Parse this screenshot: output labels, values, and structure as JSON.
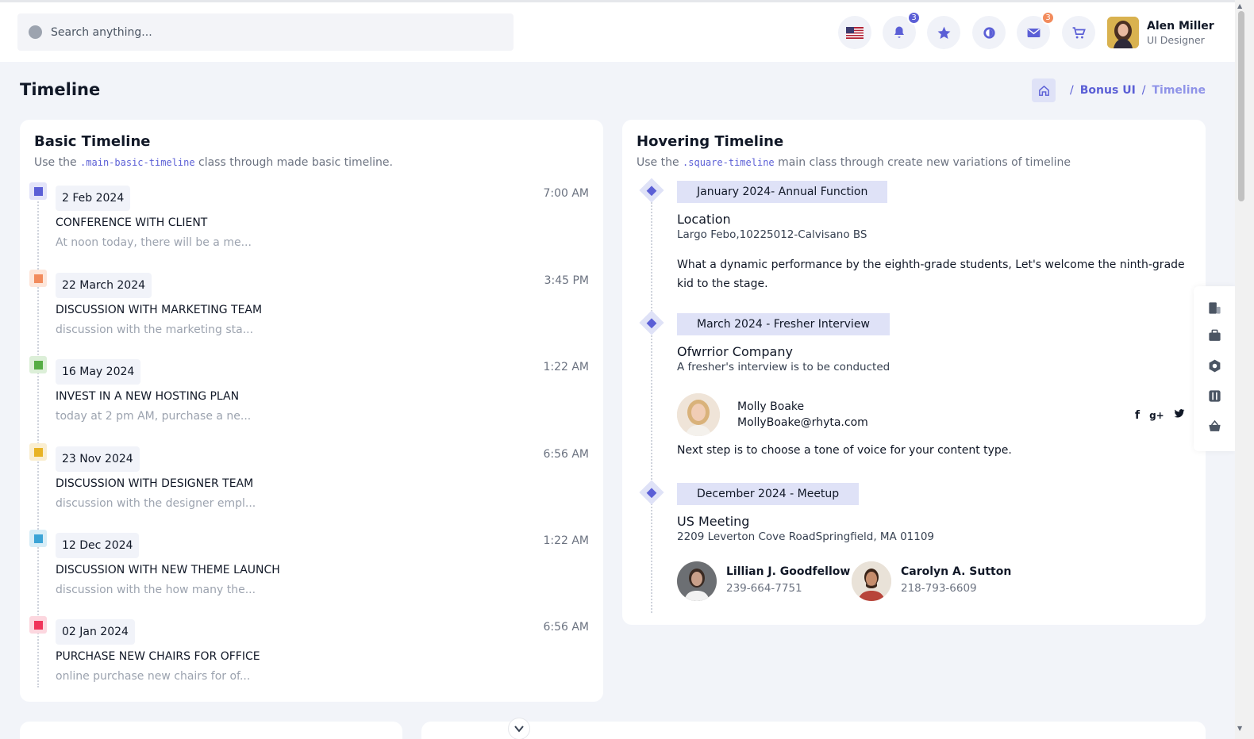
{
  "search": {
    "placeholder": "Search anything..."
  },
  "header": {
    "badges": {
      "notifications": "3",
      "messages": "3"
    },
    "user": {
      "name": "Alen Miller",
      "role": "UI Designer"
    }
  },
  "page": {
    "title": "Timeline"
  },
  "breadcrumb": {
    "parent": "Bonus UI",
    "sep1": "/",
    "sep2": "/",
    "current": "Timeline"
  },
  "basic_timeline": {
    "title": "Basic Timeline",
    "sub_before": "Use the",
    "sub_code": ".main-basic-timeline",
    "sub_after": "class through made basic timeline.",
    "items": [
      {
        "date": "2 Feb 2024",
        "time": "7:00 AM",
        "title": "CONFERENCE WITH CLIENT",
        "desc": "At noon today, there will be a me...",
        "color": "#5b5fd6",
        "bg": "#e3e4f9"
      },
      {
        "date": "22 March 2024",
        "time": "3:45 PM",
        "title": "DISCUSSION WITH MARKETING TEAM",
        "desc": "discussion with the marketing sta...",
        "color": "#f28b5c",
        "bg": "#fde6da"
      },
      {
        "date": "16 May 2024",
        "time": "1:22 AM",
        "title": "INVEST IN A NEW HOSTING PLAN",
        "desc": "today at 2 pm AM, purchase a ne...",
        "color": "#55ad44",
        "bg": "#dcefd8"
      },
      {
        "date": "23 Nov 2024",
        "time": "6:56 AM",
        "title": "DISCUSSION WITH DESIGNER TEAM",
        "desc": "discussion with the designer empl...",
        "color": "#e8b324",
        "bg": "#faeed0"
      },
      {
        "date": "12 Dec 2024",
        "time": "1:22 AM",
        "title": "DISCUSSION WITH NEW THEME LAUNCH",
        "desc": "discussion with the how many the...",
        "color": "#3ba4d6",
        "bg": "#d7edf7"
      },
      {
        "date": "02 Jan 2024",
        "time": "6:56 AM",
        "title": "PURCHASE NEW CHAIRS FOR OFFICE",
        "desc": "online purchase new chairs for of...",
        "color": "#f0345a",
        "bg": "#fcd7df"
      }
    ]
  },
  "hovering_timeline": {
    "title": "Hovering Timeline",
    "sub_before": "Use the",
    "sub_code": ".square-timeline",
    "sub_after": "main class through create new variations of timeline",
    "event1": {
      "date": "January 2024- Annual Function",
      "heading": "Location",
      "address": "Largo Febo,10225012-Calvisano BS",
      "text": "What a dynamic performance by the eighth-grade students, Let's welcome the ninth-grade kid to the stage."
    },
    "event2": {
      "date": "March 2024 - Fresher Interview",
      "heading": "Ofwrrior Company",
      "detail": "A fresher's interview is to be conducted",
      "person_name": "Molly Boake",
      "person_email": "MollyBoake@rhyta.com",
      "social": [
        "f",
        "g+",
        "t"
      ],
      "note": "Next step is to choose a tone of voice for your content type."
    },
    "event3": {
      "date": "December 2024 - Meetup",
      "heading": "US Meeting",
      "address": "2209 Leverton Cove RoadSpringfield, MA 01109",
      "people": [
        {
          "name": "Lillian J. Goodfellow",
          "phone": "239-664-7751"
        },
        {
          "name": "Carolyn A. Sutton",
          "phone": "218-793-6609"
        }
      ]
    }
  },
  "colors": {
    "accent": "#5b5fd6",
    "accent_light": "#dfe2f7",
    "badge_blue": "#5b5fd6",
    "badge_orange": "#f28b5c"
  }
}
